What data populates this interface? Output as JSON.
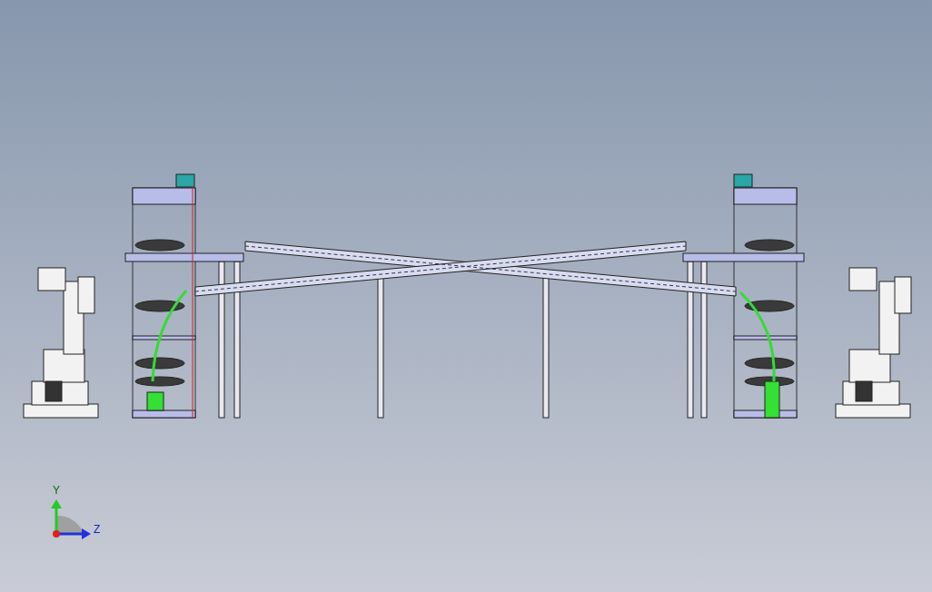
{
  "viewport": {
    "axis_labels": [
      {
        "kind": "y",
        "text": "Y"
      },
      {
        "kind": "z",
        "text": "Z"
      }
    ]
  }
}
